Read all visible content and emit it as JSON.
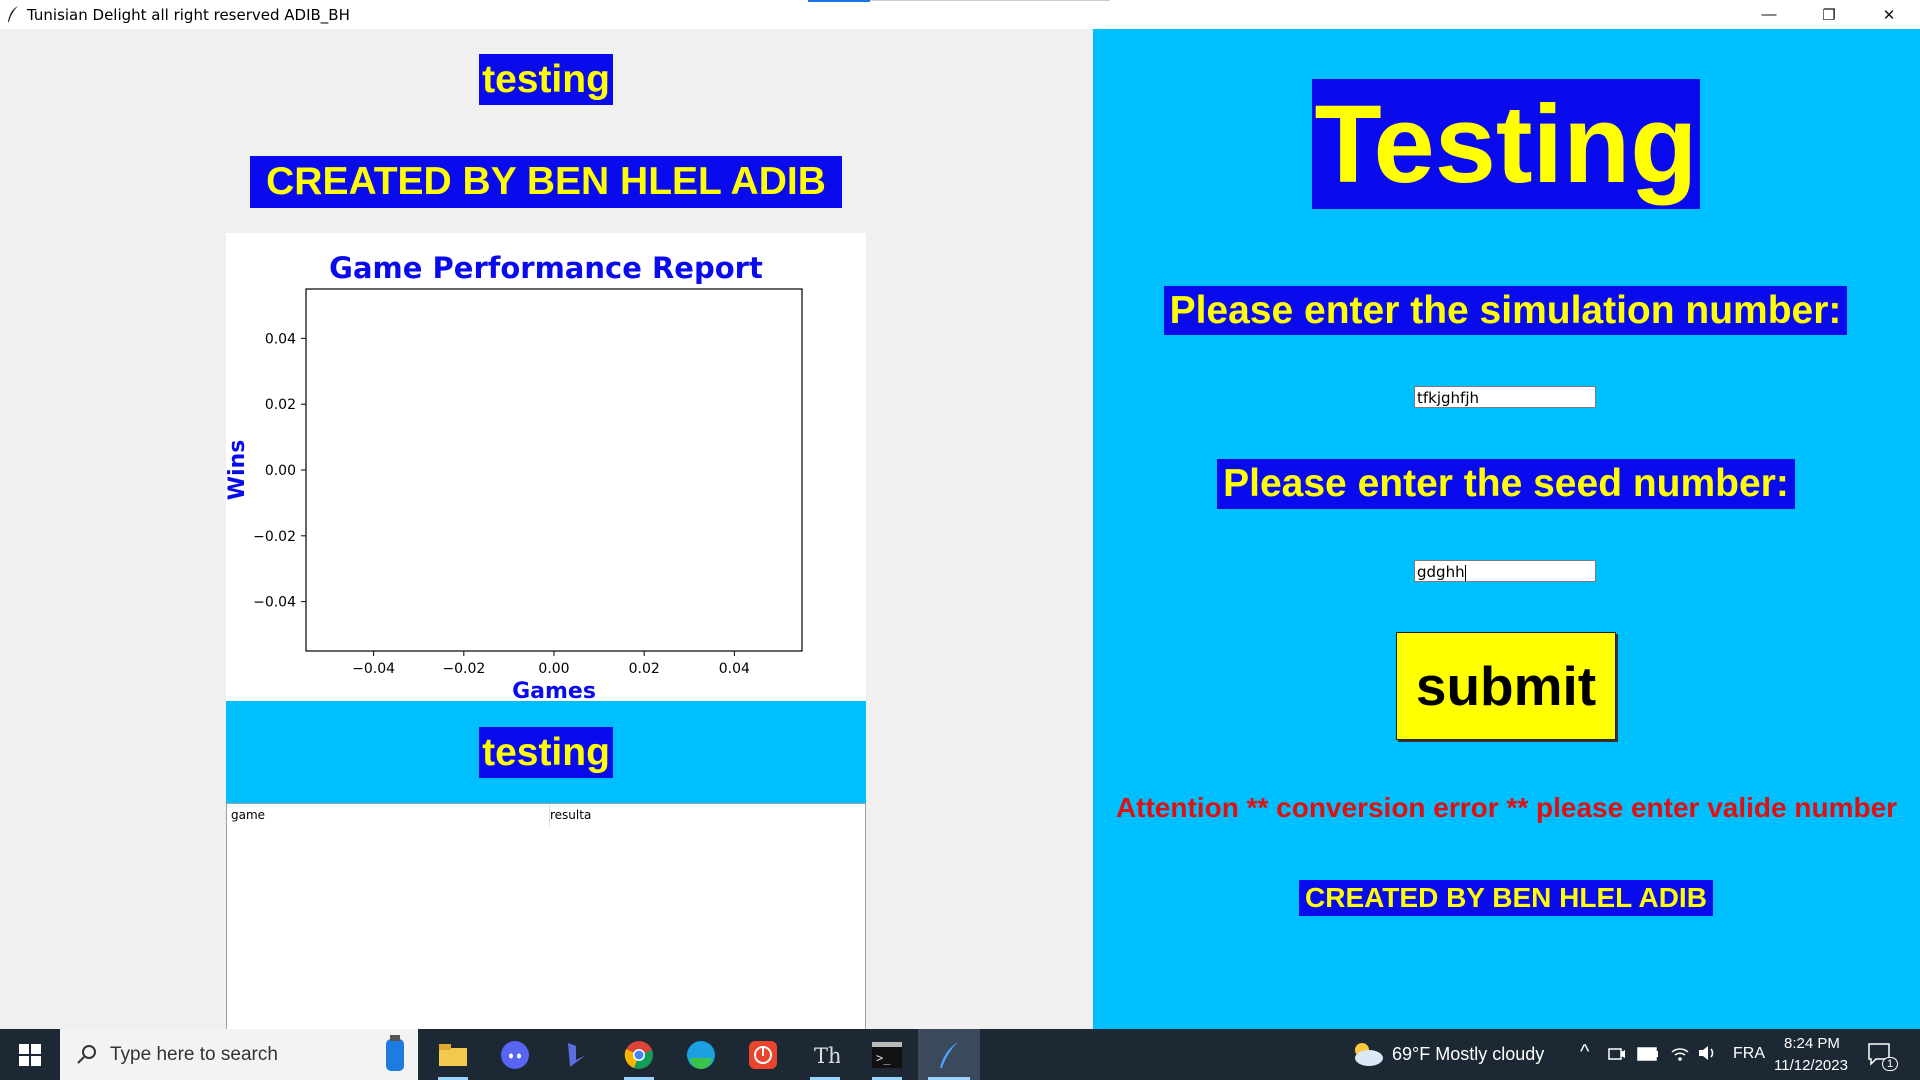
{
  "window": {
    "title": "Tunisian Delight all right reserved ADIB_BH",
    "minimize_glyph": "—",
    "restore_glyph": "❐",
    "close_glyph": "✕"
  },
  "left": {
    "top_label": "testing",
    "creator_label": "CREATED BY BEN HLEL ADIB",
    "strip_label": "testing",
    "table": {
      "columns": [
        "game",
        "resulta"
      ],
      "rows": []
    }
  },
  "chart_data": {
    "type": "line",
    "title": "Game Performance Report",
    "xlabel": "Games",
    "ylabel": "Wins",
    "x": [],
    "series": [],
    "xlim": [
      -0.055,
      0.055
    ],
    "ylim": [
      -0.055,
      0.055
    ],
    "xticks": [
      -0.04,
      -0.02,
      0.0,
      0.02,
      0.04
    ],
    "xtick_labels": [
      "−0.04",
      "−0.02",
      "0.00",
      "0.02",
      "0.04"
    ],
    "yticks": [
      0.04,
      0.02,
      0.0,
      -0.02,
      -0.04
    ],
    "ytick_labels": [
      "0.04",
      "0.02",
      "0.00",
      "−0.02",
      "−0.04"
    ],
    "grid": false
  },
  "right": {
    "title": "Testing",
    "sim_prompt": "Please enter the simulation number:",
    "sim_value": "tfkjghfjh",
    "seed_prompt": "Please enter the seed number:",
    "seed_value": "gdghh",
    "submit_label": "submit",
    "error_text": "Attention ** conversion error ** please enter valide number",
    "creator_label": "CREATED BY BEN HLEL ADIB"
  },
  "colors": {
    "label_bg": "#0a0aee",
    "label_fg": "#ffff00",
    "panel_cyan": "#00bfff",
    "error_red": "#e01010"
  },
  "taskbar": {
    "search_placeholder": "Type here to search",
    "weather": "69°F  Mostly cloudy",
    "language": "FRA",
    "time": "8:24 PM",
    "date": "11/12/2023",
    "notification_count": "1",
    "apps": [
      "file-explorer-icon",
      "discord-icon",
      "bing-icon",
      "chrome-icon",
      "edge-icon",
      "power-app-icon",
      "thonny-icon",
      "terminal-icon",
      "tk-feather-icon"
    ]
  }
}
